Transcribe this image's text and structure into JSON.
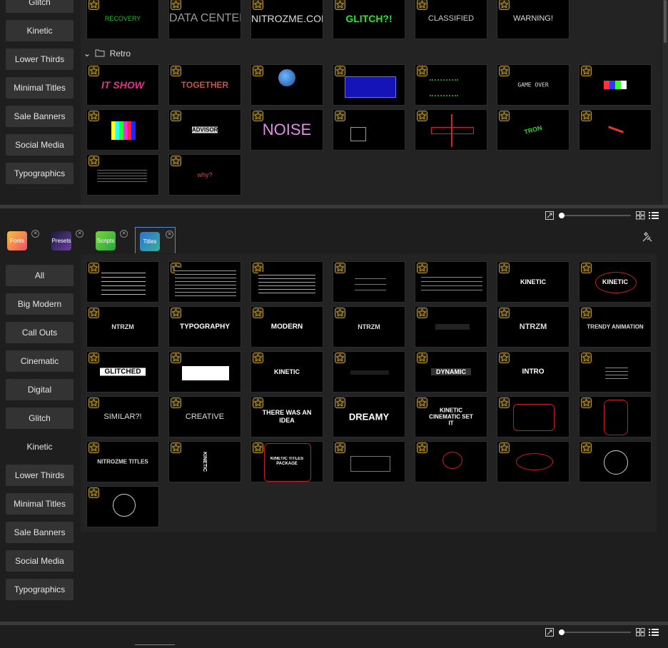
{
  "top_sidebar": [
    {
      "label": "Glitch"
    },
    {
      "label": "Kinetic"
    },
    {
      "label": "Lower Thirds"
    },
    {
      "label": "Minimal Titles"
    },
    {
      "label": "Sale Banners"
    },
    {
      "label": "Social Media"
    },
    {
      "label": "Typographics"
    }
  ],
  "top_grid": {
    "row_partial": [
      "RECOVERY",
      "DATA CENTER",
      "NITROZME.COM",
      "GLITCH?!",
      "CLASSIFIED",
      "WARNING!"
    ],
    "folder_label": "Retro",
    "retro_row1": [
      "IT SHOW",
      "TOGETHER",
      "",
      "",
      "",
      "GAME OVER",
      ""
    ],
    "retro_row2": [
      "",
      "ADVISORY",
      "NOISE",
      "",
      "",
      "TRON",
      ""
    ],
    "retro_row3": [
      "",
      "why?"
    ]
  },
  "tabs": [
    {
      "label": "Fonts",
      "color": "#f6a13a"
    },
    {
      "label": "Presets",
      "color": "#3b2e6e"
    },
    {
      "label": "Scripts",
      "color": "#4fbe3b"
    },
    {
      "label": "Titles",
      "color": "#2f6fd6"
    }
  ],
  "bottom_sidebar": [
    {
      "label": "All"
    },
    {
      "label": "Big Modern"
    },
    {
      "label": "Call Outs"
    },
    {
      "label": "Cinematic"
    },
    {
      "label": "Digital"
    },
    {
      "label": "Glitch"
    },
    {
      "label": "Kinetic"
    },
    {
      "label": "Lower Thirds"
    },
    {
      "label": "Minimal Titles"
    },
    {
      "label": "Sale Banners"
    },
    {
      "label": "Social Media"
    },
    {
      "label": "Typographics"
    }
  ],
  "bottom_grid": {
    "row1": [
      "",
      "",
      "",
      "",
      "",
      "KINETIC",
      "KINETIC"
    ],
    "row2": [
      "NTRZM",
      "TYPOGRAPHY",
      "MODERN",
      "NTRZM",
      "",
      "NTRZM",
      "TRENDY ANIMATION"
    ],
    "row3": [
      "GLITCHED",
      "",
      "KINETIC",
      "",
      "DYNAMIC",
      "INTRO",
      ""
    ],
    "row4": [
      "SIMILAR?!",
      "CREATIVE",
      "THERE WAS AN IDEA",
      "DREAMY",
      "KINETIC CINEMATIC SET IT",
      "",
      ""
    ],
    "row5": [
      "NITROZME TITLES",
      "KINETIC",
      "KINETIC TITLES PACKAGE",
      "",
      "",
      "",
      ""
    ],
    "row6": [
      ""
    ]
  },
  "colors": {
    "accent": "#4a8fd6",
    "star": "#c9a227",
    "panel": "#232323",
    "button": "#333333"
  }
}
